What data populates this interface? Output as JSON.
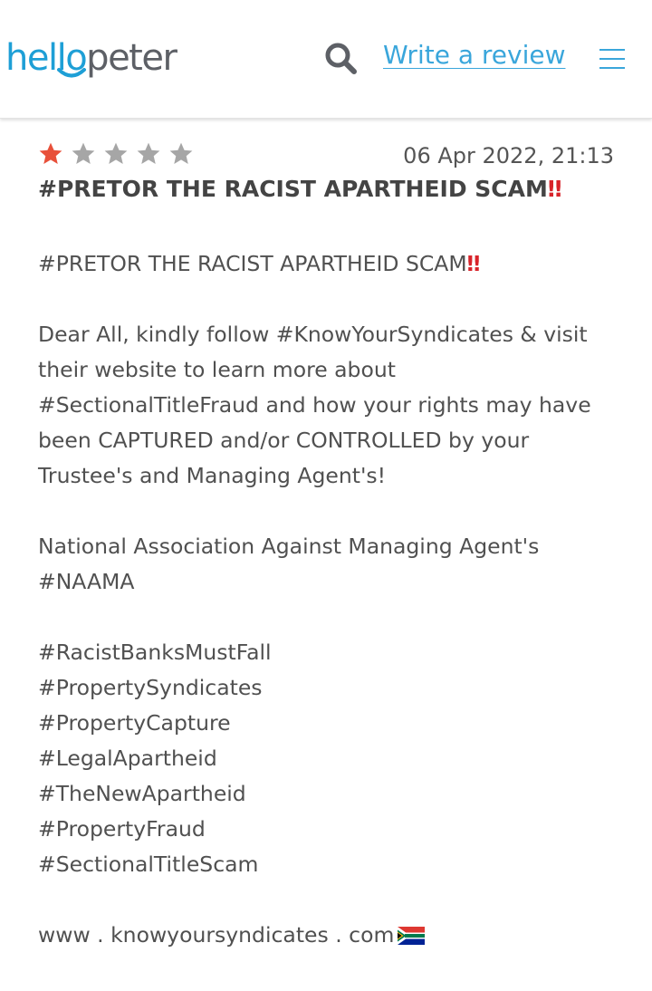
{
  "header": {
    "logo_hello": "hello",
    "logo_peter": "peter",
    "search_icon": "search-icon",
    "write_review": "Write a review",
    "menu_icon": "hamburger-menu-icon"
  },
  "review": {
    "rating": 1,
    "max_rating": 5,
    "star_colors": {
      "filled": "#e8503a",
      "empty": "#a6a6a6"
    },
    "date": "06 Apr 2022, 21:13",
    "title": "#PRETOR THE RACIST APARTHEID SCAM",
    "title_emoji": "‼",
    "body": {
      "heading_line": "#PRETOR THE RACIST APARTHEID SCAM",
      "heading_emoji": "‼",
      "paragraph_lines": [
        "Dear All, kindly follow #KnowYourSyndicates & visit",
        "their website to learn more about",
        "#SectionalTitleFraud and how your rights may have",
        "been CAPTURED and/or CONTROLLED by your",
        "Trustee's and Managing Agent's!"
      ],
      "association_lines": [
        "National Association Against Managing Agent's",
        "#NAAMA"
      ],
      "hashtags": [
        "#RacistBanksMustFall",
        "#PropertySyndicates",
        "#PropertyCapture",
        "#LegalApartheid",
        "#TheNewApartheid",
        "#PropertyFraud",
        "#SectionalTitleScam"
      ],
      "website": "www . knowyoursyndicates . com",
      "website_emoji": "south-africa-flag-icon"
    }
  },
  "colors": {
    "brand_blue": "#1e9fd6",
    "brand_grey": "#5d6066",
    "link_blue": "#3aa6db",
    "alert_red": "#d8232a"
  }
}
